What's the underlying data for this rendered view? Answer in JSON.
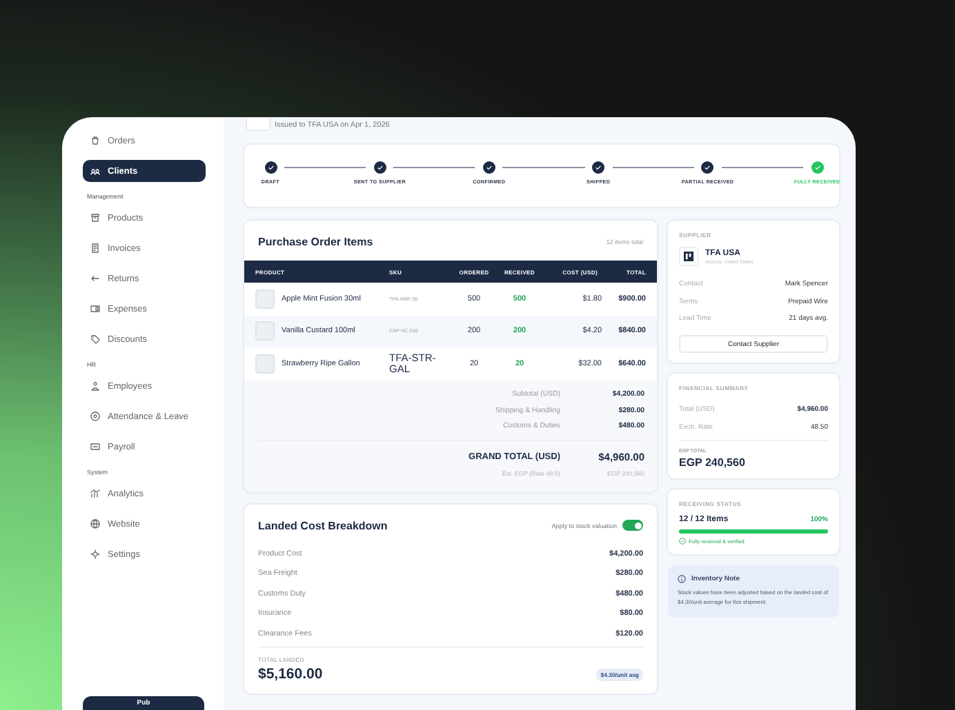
{
  "sidebar": {
    "items": [
      {
        "kind": "item",
        "label": "Orders",
        "selected": false
      },
      {
        "kind": "item",
        "label": "Clients",
        "selected": true
      },
      {
        "kind": "section",
        "label": "Management"
      },
      {
        "kind": "item",
        "label": "Products",
        "selected": false
      },
      {
        "kind": "item",
        "label": "Invoices",
        "selected": false
      },
      {
        "kind": "item",
        "label": "Returns",
        "selected": false
      },
      {
        "kind": "item",
        "label": "Expenses",
        "selected": false
      },
      {
        "kind": "item",
        "label": "Discounts",
        "selected": false
      },
      {
        "kind": "section",
        "label": "HR"
      },
      {
        "kind": "item",
        "label": "Employees",
        "selected": false
      },
      {
        "kind": "item",
        "label": "Attendance & Leave",
        "selected": false
      },
      {
        "kind": "item",
        "label": "Payroll",
        "selected": false
      },
      {
        "kind": "section",
        "label": "System"
      },
      {
        "kind": "item",
        "label": "Analytics",
        "selected": false
      },
      {
        "kind": "item",
        "label": "Website",
        "selected": false
      },
      {
        "kind": "item",
        "label": "Settings",
        "selected": false
      }
    ],
    "bottom_button": "Pub"
  },
  "header": {
    "subtitle": "Issued to TFA USA on Apr 1, 2026"
  },
  "stepper": [
    {
      "label": "DRAFT",
      "current": false
    },
    {
      "label": "SENT TO SUPPLIER",
      "current": false
    },
    {
      "label": "CONFIRMED",
      "current": false
    },
    {
      "label": "SHIPPED",
      "current": false
    },
    {
      "label": "PARTIAL RECEIVED",
      "current": false
    },
    {
      "label": "FULLY RECEIVED",
      "current": true
    }
  ],
  "po_items": {
    "title": "Purchase Order Items",
    "count": "12 items total",
    "columns": [
      "PRODUCT",
      "SKU",
      "ORDERED",
      "RECEIVED",
      "COST (USD)",
      "TOTAL"
    ],
    "rows": [
      {
        "product": "Apple Mint Fusion 30ml",
        "sku": "TFA-AMF-30",
        "kind": "code",
        "ordered": "500",
        "received": "500",
        "cost": "$1.80",
        "total": "$900.00"
      },
      {
        "product": "Vanilla Custard 100ml",
        "sku": "CAP-VC-100",
        "kind": "code",
        "ordered": "200",
        "received": "200",
        "cost": "$4.20",
        "total": "$840.00"
      },
      {
        "product": "Strawberry Ripe Gallon",
        "sku": "TFA-STR-GAL",
        "kind": "plain",
        "ordered": "20",
        "received": "20",
        "cost": "$32.00",
        "total": "$640.00"
      }
    ],
    "summary": [
      {
        "label": "Subtotal (USD)",
        "value": "$4,200.00"
      },
      {
        "label": "Shipping & Handling",
        "value": "$280.00"
      },
      {
        "label": "Customs & Duties",
        "value": "$480.00"
      }
    ],
    "grand_total": {
      "label": "GRAND TOTAL (USD)",
      "value": "$4,960.00"
    },
    "estimate": {
      "label": "Est. EGP (Rate 48.5)",
      "value": "EGP 240,560"
    }
  },
  "landed_cost": {
    "title": "Landed Cost Breakdown",
    "toggle": {
      "label": "Apply to stock valuation",
      "on": true
    },
    "rows": [
      {
        "label": "Product Cost",
        "value": "$4,200.00"
      },
      {
        "label": "Sea Freight",
        "value": "$280.00"
      },
      {
        "label": "Customs Duty",
        "value": "$480.00"
      },
      {
        "label": "Insurance",
        "value": "$80.00"
      },
      {
        "label": "Clearance Fees",
        "value": "$120.00"
      }
    ],
    "total_label": "TOTAL LANDED",
    "total": "$5,160.00",
    "unit_badge": "$4.30/unit avg"
  },
  "supplier": {
    "heading": "SUPPLIER",
    "name": "TFA USA",
    "location": "Arizona, United States",
    "details": [
      {
        "label": "Contact",
        "value": "Mark Spencer"
      },
      {
        "label": "Terms",
        "value": "Prepaid Wire"
      },
      {
        "label": "Lead Time",
        "value": "21 days avg."
      }
    ],
    "button": "Contact Supplier"
  },
  "financial_summary": {
    "heading": "FINANCIAL SUMMARY",
    "rows": [
      {
        "label": "Total (USD)",
        "value": "$4,960.00",
        "emphasis": true
      },
      {
        "label": "Exch. Rate",
        "value": "48.50",
        "emphasis": false
      }
    ],
    "egp_label": "EGP TOTAL",
    "egp_value": "EGP 240,560"
  },
  "receiving_status": {
    "heading": "RECEIVING STATUS",
    "count": "12 / 12 Items",
    "percent": "100%",
    "level": 1,
    "note": "Fully received & verified"
  },
  "inventory_note": {
    "title": "Inventory Note",
    "text": "Stock values have been adjusted based on the landed cost of $4.30/unit average for this shipment."
  }
}
